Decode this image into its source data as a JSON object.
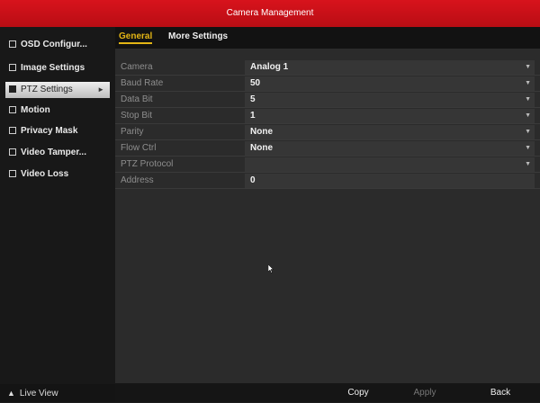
{
  "window": {
    "title": "Camera Management"
  },
  "sidebar": {
    "items": [
      {
        "label": "OSD Configur...",
        "icon": "osd-icon"
      },
      {
        "label": "Image Settings",
        "icon": "image-icon"
      },
      {
        "label": "PTZ Settings",
        "icon": "ptz-icon",
        "active": true,
        "arrow": "►"
      },
      {
        "label": "Motion",
        "icon": "motion-icon"
      },
      {
        "label": "Privacy Mask",
        "icon": "privacy-mask-icon"
      },
      {
        "label": "Video Tamper...",
        "icon": "video-tamper-icon"
      },
      {
        "label": "Video Loss",
        "icon": "video-loss-icon"
      }
    ],
    "live_view": {
      "label": "Live View",
      "icon": "home-icon",
      "glyph": "▲"
    }
  },
  "tabs": [
    {
      "label": "General",
      "active": true
    },
    {
      "label": "More Settings",
      "active": false
    }
  ],
  "settings": [
    {
      "label": "Camera",
      "value": "Analog 1",
      "dropdown": true
    },
    {
      "label": "Baud Rate",
      "value": "50",
      "dropdown": true
    },
    {
      "label": "Data Bit",
      "value": "5",
      "dropdown": true
    },
    {
      "label": "Stop Bit",
      "value": "1",
      "dropdown": true
    },
    {
      "label": "Parity",
      "value": "None",
      "dropdown": true
    },
    {
      "label": "Flow Ctrl",
      "value": "None",
      "dropdown": true
    },
    {
      "label": "PTZ Protocol",
      "value": "",
      "dropdown": true
    },
    {
      "label": "Address",
      "value": "0",
      "dropdown": false
    }
  ],
  "buttons": {
    "copy": "Copy",
    "apply": "Apply",
    "back": "Back"
  },
  "colors": {
    "title_bar": "#c8101a",
    "active_tab": "#e3b515"
  }
}
